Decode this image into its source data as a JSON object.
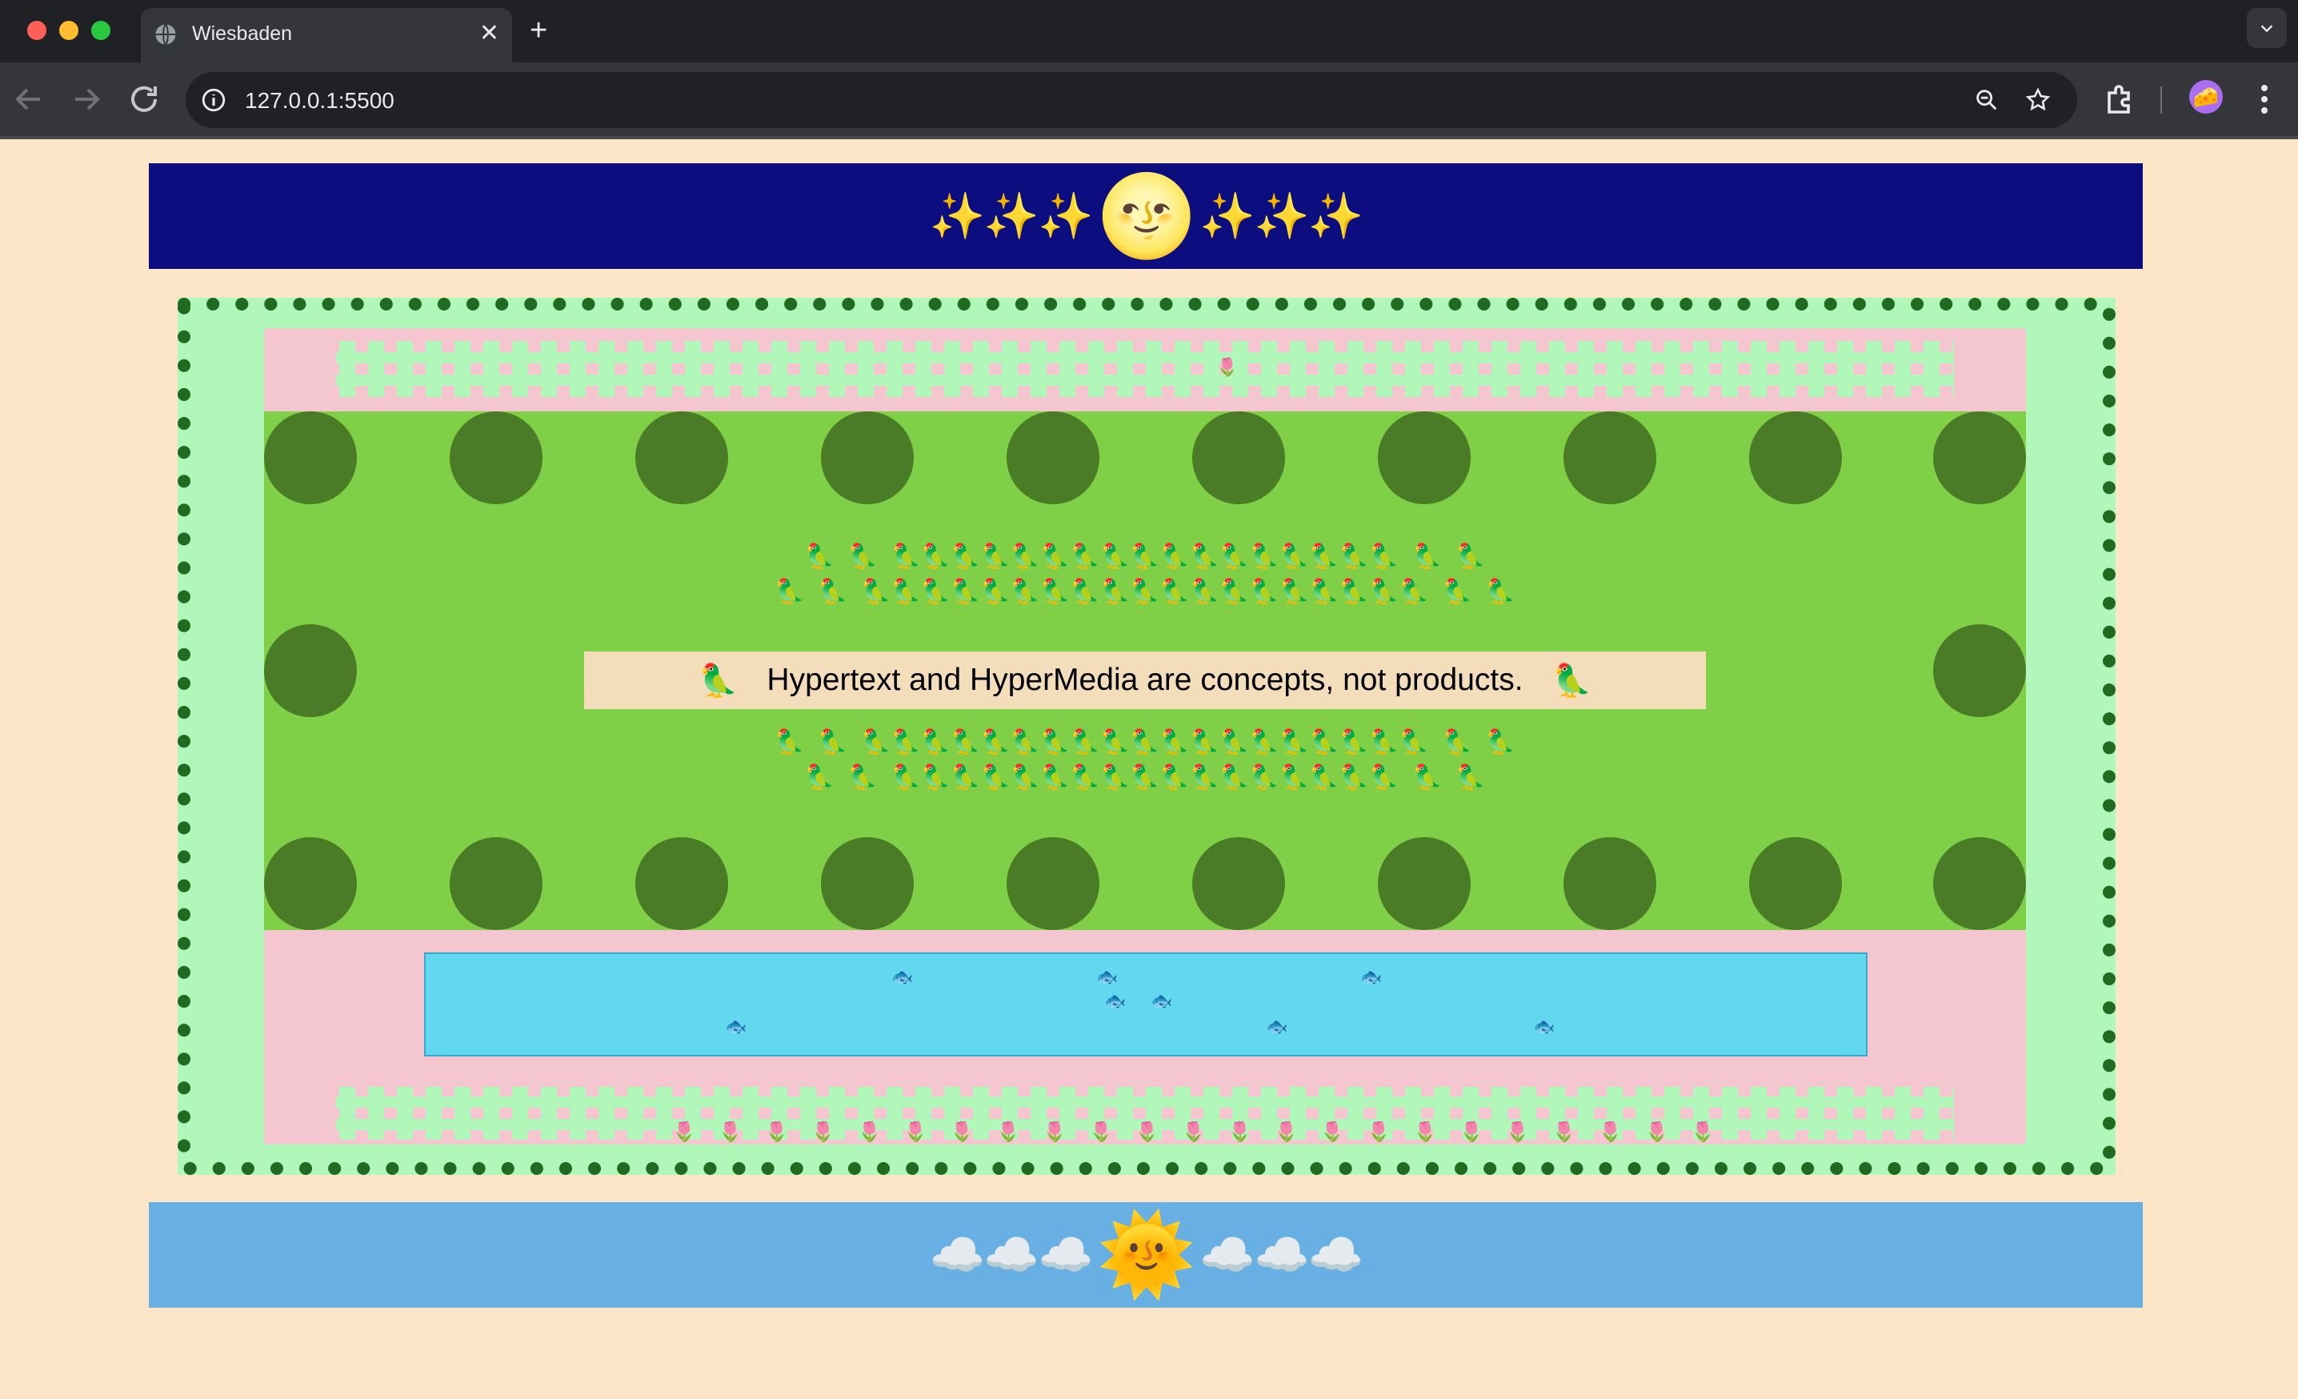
{
  "browser": {
    "tab_title": "Wiesbaden",
    "tab_close": "✕",
    "new_tab": "+",
    "tab_menu": "⌄",
    "url": "127.0.0.1:5500",
    "traffic_lights": {
      "close": "#ff5f57",
      "minimize": "#febc2e",
      "maximize": "#28c840"
    },
    "avatar": "🧀"
  },
  "page": {
    "night_banner": {
      "left": "✨✨✨",
      "center": "🌝",
      "right": "✨✨✨"
    },
    "day_banner": {
      "left": "☁️☁️☁️",
      "center": "🌞",
      "right": "☁️☁️☁️"
    },
    "garden": {
      "top_tulip": "🌷",
      "bird_rows": [
        "🦜  🦜  🦜🦜🦜🦜🦜🦜🦜🦜🦜🦜🦜🦜🦜🦜🦜🦜🦜  🦜  🦜",
        "🦜  🦜  🦜🦜🦜🦜🦜🦜🦜🦜🦜🦜🦜🦜🦜🦜🦜🦜🦜🦜🦜  🦜  🦜",
        "🦜  🦜  🦜🦜🦜🦜🦜🦜🦜🦜🦜🦜🦜🦜🦜🦜🦜🦜🦜🦜🦜  🦜  🦜",
        "🦜  🦜  🦜🦜🦜🦜🦜🦜🦜🦜🦜🦜🦜🦜🦜🦜🦜🦜🦜  🦜  🦜"
      ],
      "banner_parrot": "🦜",
      "banner_text": "Hypertext and HyperMedia are concepts, not products.",
      "fish": "🐟",
      "bottom_tulips": "🌷🌷🌷🌷🌷🌷🌷🌷🌷🌷🌷🌷🌷🌷🌷🌷🌷🌷🌷🌷🌷🌷🌷"
    }
  },
  "colors": {
    "page_bg": "#fde6c8",
    "night": "#0c0e80",
    "day": "#68afe3",
    "garden_border": "#b0f7b9",
    "garden_dots": "#1f6b22",
    "flowerbed": "#f4c6cf",
    "lawn": "#7fcf47",
    "tree": "#4a7c27",
    "pond": "#62d8ef"
  }
}
